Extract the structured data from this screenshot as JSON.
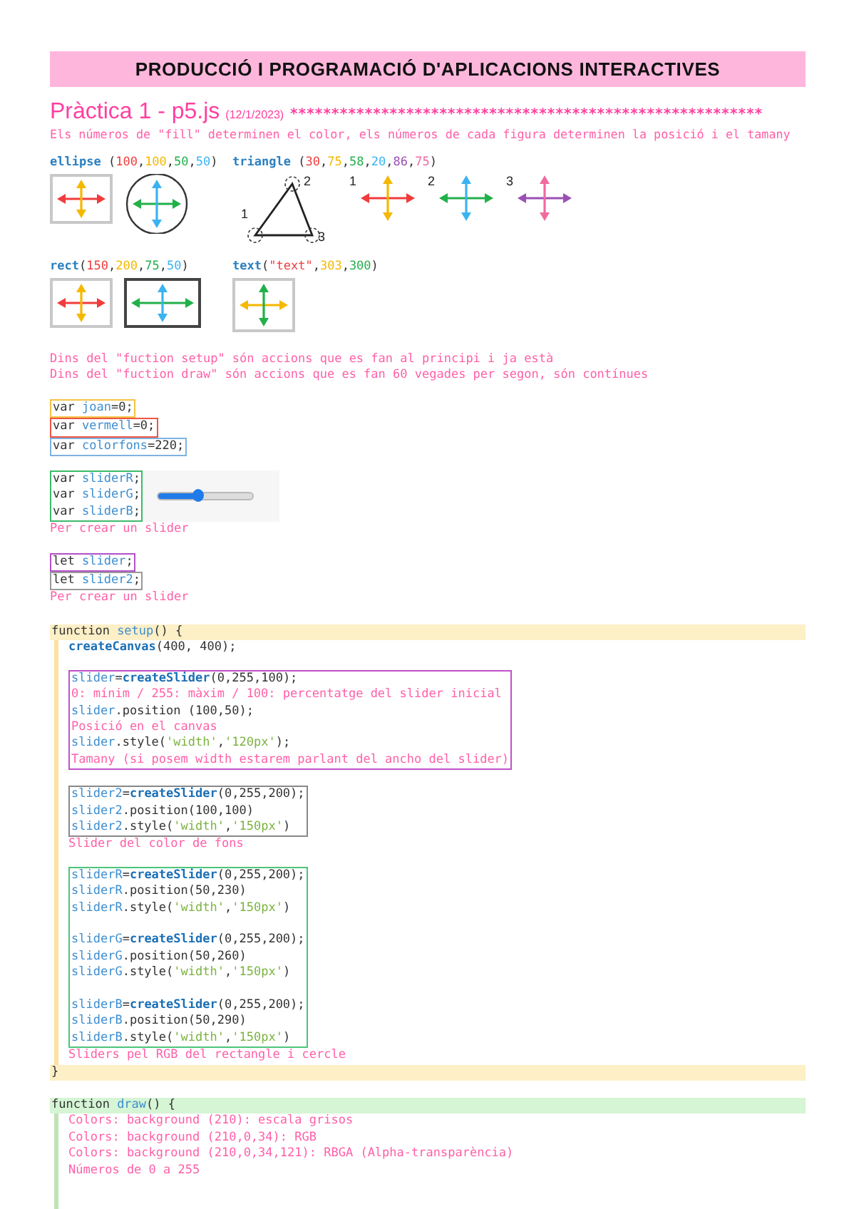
{
  "title": "PRODUCCIÓ I PROGRAMACIÓ D'APLICACIONS INTERACTIVES",
  "practice": {
    "heading": "Pràctica 1 - p5.js",
    "date": "(12/1/2023)",
    "stars": "*********************************************************"
  },
  "intro": "Els números de \"fill\" determinen el color, els números de cada figura determinen la posició i el tamany",
  "shapes": [
    {
      "kind": "ellipse",
      "call": "ellipse",
      "open": " (",
      "sep": ",",
      "close": ")",
      "args": [
        {
          "text": "100",
          "color": "#f03c3c"
        },
        {
          "text": "100",
          "color": "#f5b800"
        },
        {
          "text": "50",
          "color": "#22b04b"
        },
        {
          "text": "50",
          "color": "#3bb3f0"
        }
      ]
    },
    {
      "kind": "triangle",
      "call": "triangle",
      "open": " (",
      "sep": ",",
      "close": ")",
      "args": [
        {
          "text": "30",
          "color": "#f03c3c"
        },
        {
          "text": "75",
          "color": "#f5b800"
        },
        {
          "text": "58",
          "color": "#22b04b"
        },
        {
          "text": "20",
          "color": "#3bb3f0"
        },
        {
          "text": "86",
          "color": "#9b4fb5"
        },
        {
          "text": "75",
          "color": "#f06aa0"
        }
      ],
      "vertex_labels": [
        "1",
        "2",
        "3"
      ],
      "legend_labels": [
        "1",
        "2",
        "3"
      ]
    },
    {
      "kind": "rect",
      "call": "rect",
      "open": "(",
      "sep": ",",
      "close": ")",
      "args": [
        {
          "text": "150",
          "color": "#f03c3c"
        },
        {
          "text": "200",
          "color": "#f5b800"
        },
        {
          "text": "75",
          "color": "#22b04b"
        },
        {
          "text": "50",
          "color": "#3bb3f0"
        }
      ]
    },
    {
      "kind": "text",
      "call": "text",
      "open": "(",
      "sep": ",",
      "close": ")",
      "args": [
        {
          "text": "\"text\"",
          "color": "#f03c3c"
        },
        {
          "text": "303",
          "color": "#f5b800"
        },
        {
          "text": "300",
          "color": "#22b04b"
        }
      ]
    }
  ],
  "notes": [
    "Dins del \"fuction setup\" són accions que es fan al principi i ja està",
    "Dins del \"fuction draw\" són accions que es fan 60 vegades per segon, són contínues"
  ],
  "declarations": [
    [
      {
        "kind": "box",
        "color": "#f5c242",
        "sections": [
          [
            [
              {
                "t": "var ",
                "kind": "kw"
              },
              {
                "t": "joan",
                "kind": "var"
              },
              {
                "t": "=0;",
                "kind": "kw"
              }
            ]
          ]
        ]
      },
      {
        "kind": "box",
        "color": "#ee5544",
        "sections": [
          [
            [
              {
                "t": "var ",
                "kind": "kw"
              },
              {
                "t": "vermell",
                "kind": "var"
              },
              {
                "t": "=0;",
                "kind": "kw"
              }
            ]
          ]
        ]
      },
      {
        "kind": "box",
        "color": "#7fb2e0",
        "sections": [
          [
            [
              {
                "t": "var ",
                "kind": "kw"
              },
              {
                "t": "colorfons",
                "kind": "var"
              },
              {
                "t": "=220;",
                "kind": "kw"
              }
            ]
          ]
        ]
      }
    ],
    [
      {
        "kind": "box",
        "color": "#3cba6a",
        "slider": {
          "level": 0.42
        },
        "sections": [
          [
            [
              {
                "t": "var ",
                "kind": "kw"
              },
              {
                "t": "sliderR",
                "kind": "var"
              },
              {
                "t": ";",
                "kind": "kw"
              }
            ],
            [
              {
                "t": "var ",
                "kind": "kw"
              },
              {
                "t": "sliderG",
                "kind": "var"
              },
              {
                "t": ";",
                "kind": "kw"
              }
            ],
            [
              {
                "t": "var ",
                "kind": "kw"
              },
              {
                "t": "sliderB",
                "kind": "var"
              },
              {
                "t": ";",
                "kind": "kw"
              }
            ]
          ]
        ]
      },
      {
        "kind": "note",
        "text": "Per crear un slider"
      }
    ],
    [
      {
        "kind": "box",
        "color": "#b44fc8",
        "sections": [
          [
            [
              {
                "t": "let ",
                "kind": "kw"
              },
              {
                "t": "slider",
                "kind": "var"
              },
              {
                "t": ";",
                "kind": "kw"
              }
            ]
          ]
        ]
      },
      {
        "kind": "box",
        "color": "#999999",
        "sections": [
          [
            [
              {
                "t": "let ",
                "kind": "kw"
              },
              {
                "t": "slider2",
                "kind": "var"
              },
              {
                "t": ";",
                "kind": "kw"
              }
            ]
          ]
        ]
      },
      {
        "kind": "note",
        "text": "Per crear un slider"
      }
    ]
  ],
  "setup": {
    "header": [
      {
        "t": "function ",
        "kind": "kw"
      },
      {
        "t": "setup",
        "kind": "var"
      },
      {
        "t": "() {",
        "kind": "kw"
      }
    ],
    "body": [
      {
        "kind": "line",
        "tokens": [
          {
            "t": "createCanvas",
            "kind": "fn"
          },
          {
            "t": "(400, 400);",
            "kind": "kw"
          }
        ]
      },
      {
        "kind": "box",
        "color": "#c050c8",
        "sections": [
          [
            [
              {
                "t": "slider",
                "kind": "var"
              },
              {
                "t": "=",
                "kind": "kw"
              },
              {
                "t": "createSlider",
                "kind": "fn"
              },
              {
                "t": "(0,255,100);",
                "kind": "kw"
              }
            ],
            [
              {
                "t": "0: mínim / 255: màxim / 100: percentatge del slider inicial",
                "kind": "note"
              }
            ],
            [
              {
                "t": "slider",
                "kind": "var"
              },
              {
                "t": ".position (100,50);",
                "kind": "kw"
              }
            ],
            [
              {
                "t": "Posició en el canvas",
                "kind": "note"
              }
            ],
            [
              {
                "t": "slider",
                "kind": "var"
              },
              {
                "t": ".style(",
                "kind": "kw"
              },
              {
                "t": "'width'",
                "kind": "str"
              },
              {
                "t": ",",
                "kind": "kw"
              },
              {
                "t": "'120px'",
                "kind": "str"
              },
              {
                "t": ");",
                "kind": "kw"
              }
            ],
            [
              {
                "t": "Tamany (si posem width estarem parlant del ancho del slider)",
                "kind": "note"
              }
            ]
          ]
        ]
      },
      {
        "kind": "box",
        "color": "#888888",
        "sections": [
          [
            [
              {
                "t": "slider2",
                "kind": "var"
              },
              {
                "t": "=",
                "kind": "kw"
              },
              {
                "t": "createSlider",
                "kind": "fn"
              },
              {
                "t": "(0,255,200);",
                "kind": "kw"
              }
            ],
            [
              {
                "t": "slider2",
                "kind": "var"
              },
              {
                "t": ".position(100,100)",
                "kind": "kw"
              }
            ],
            [
              {
                "t": "slider2",
                "kind": "var"
              },
              {
                "t": ".style(",
                "kind": "kw"
              },
              {
                "t": "'width'",
                "kind": "str"
              },
              {
                "t": ",",
                "kind": "kw"
              },
              {
                "t": "'150px'",
                "kind": "str"
              },
              {
                "t": ")",
                "kind": "kw"
              }
            ]
          ]
        ]
      },
      {
        "kind": "note",
        "text": "Slider del color de fons"
      },
      {
        "kind": "box",
        "color": "#4cc47a",
        "sections": [
          [
            [
              {
                "t": "sliderR",
                "kind": "var"
              },
              {
                "t": "=",
                "kind": "kw"
              },
              {
                "t": "createSlider",
                "kind": "fn"
              },
              {
                "t": "(0,255,200);",
                "kind": "kw"
              }
            ],
            [
              {
                "t": "sliderR",
                "kind": "var"
              },
              {
                "t": ".position(50,230)",
                "kind": "kw"
              }
            ],
            [
              {
                "t": "sliderR",
                "kind": "var"
              },
              {
                "t": ".style(",
                "kind": "kw"
              },
              {
                "t": "'width'",
                "kind": "str"
              },
              {
                "t": ",",
                "kind": "kw"
              },
              {
                "t": "'150px'",
                "kind": "str"
              },
              {
                "t": ")",
                "kind": "kw"
              }
            ]
          ],
          [
            [
              {
                "t": "sliderG",
                "kind": "var"
              },
              {
                "t": "=",
                "kind": "kw"
              },
              {
                "t": "createSlider",
                "kind": "fn"
              },
              {
                "t": "(0,255,200);",
                "kind": "kw"
              }
            ],
            [
              {
                "t": "sliderG",
                "kind": "var"
              },
              {
                "t": ".position(50,260)",
                "kind": "kw"
              }
            ],
            [
              {
                "t": "sliderG",
                "kind": "var"
              },
              {
                "t": ".style(",
                "kind": "kw"
              },
              {
                "t": "'width'",
                "kind": "str"
              },
              {
                "t": ",",
                "kind": "kw"
              },
              {
                "t": "'150px'",
                "kind": "str"
              },
              {
                "t": ")",
                "kind": "kw"
              }
            ]
          ],
          [
            [
              {
                "t": "sliderB",
                "kind": "var"
              },
              {
                "t": "=",
                "kind": "kw"
              },
              {
                "t": "createSlider",
                "kind": "fn"
              },
              {
                "t": "(0,255,200);",
                "kind": "kw"
              }
            ],
            [
              {
                "t": "sliderB",
                "kind": "var"
              },
              {
                "t": ".position(50,290)",
                "kind": "kw"
              }
            ],
            [
              {
                "t": "sliderB",
                "kind": "var"
              },
              {
                "t": ".style(",
                "kind": "kw"
              },
              {
                "t": "'width'",
                "kind": "str"
              },
              {
                "t": ",",
                "kind": "kw"
              },
              {
                "t": "'150px'",
                "kind": "str"
              },
              {
                "t": ")",
                "kind": "kw"
              }
            ]
          ]
        ]
      },
      {
        "kind": "note",
        "text": "Sliders pel RGB del rectangle i cercle"
      }
    ],
    "closing": [
      {
        "t": "}",
        "kind": "kw"
      }
    ]
  },
  "draw": {
    "header": [
      {
        "t": "function ",
        "kind": "kw"
      },
      {
        "t": "draw",
        "kind": "var"
      },
      {
        "t": "() {",
        "kind": "kw"
      }
    ],
    "body": [
      {
        "kind": "note",
        "text": "Colors: background (210): escala grisos"
      },
      {
        "kind": "note",
        "text": "Colors: background (210,0,34): RGB"
      },
      {
        "kind": "note",
        "text": "Colors: background (210,0,34,121): RBGA (Alpha-transparència)"
      },
      {
        "kind": "note",
        "text": "Números de 0 a 255"
      }
    ]
  }
}
